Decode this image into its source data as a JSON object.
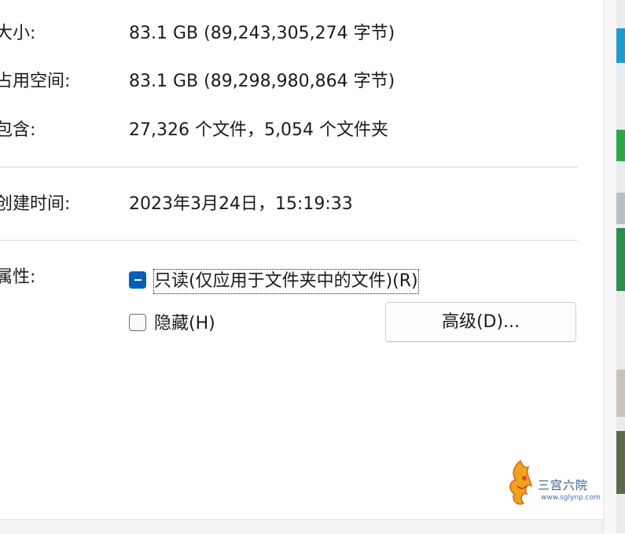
{
  "properties": {
    "size": {
      "label": "大小:",
      "value": "83.1 GB (89,243,305,274 字节)"
    },
    "size_on_disk": {
      "label": "占用空间:",
      "value": "83.1 GB (89,298,980,864 字节)"
    },
    "contains": {
      "label": "包含:",
      "value": "27,326 个文件，5,054 个文件夹"
    },
    "created": {
      "label": "创建时间:",
      "value": "2023年3月24日，15:19:33"
    }
  },
  "attributes": {
    "label": "属性:",
    "readonly": {
      "label": "只读(仅应用于文件夹中的文件)(R)",
      "state": "indeterminate"
    },
    "hidden": {
      "label": "隐藏(H)",
      "state": "unchecked"
    },
    "advanced_button": "高级(D)..."
  },
  "watermark": {
    "text": "三宫六院",
    "url": "www.sglynp.com"
  }
}
